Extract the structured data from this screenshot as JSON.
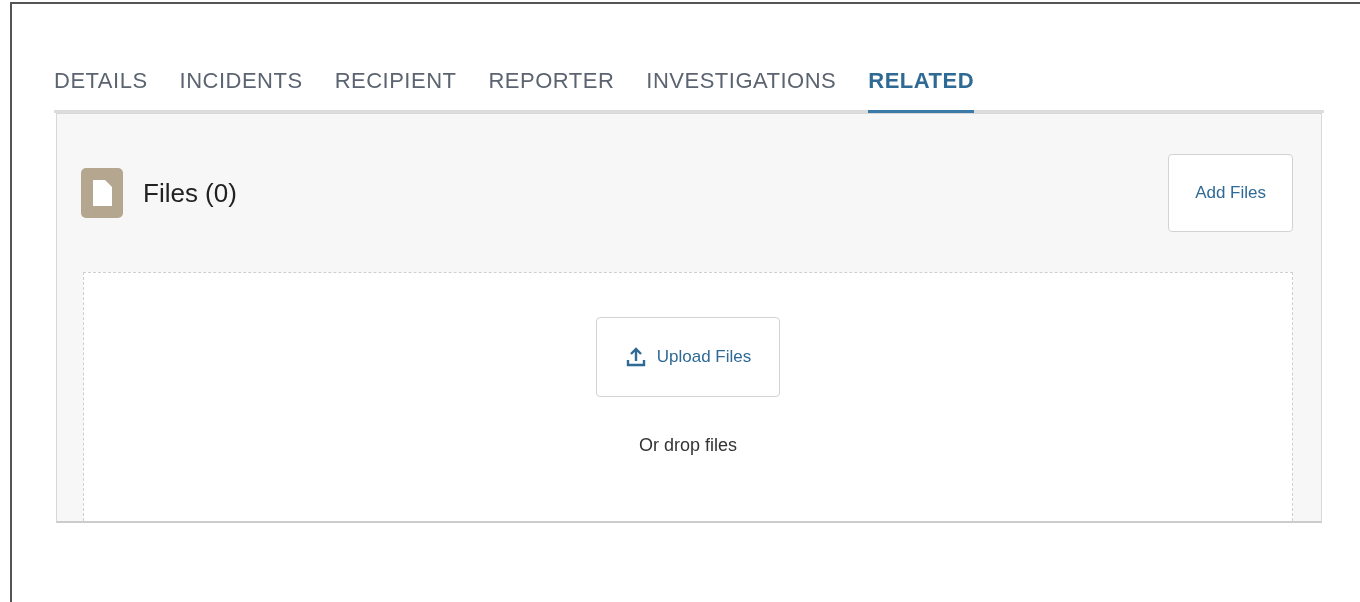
{
  "tabs": [
    {
      "label": "DETAILS",
      "selected": false
    },
    {
      "label": "INCIDENTS",
      "selected": false
    },
    {
      "label": "RECIPIENT",
      "selected": false
    },
    {
      "label": "REPORTER",
      "selected": false
    },
    {
      "label": "INVESTIGATIONS",
      "selected": false
    },
    {
      "label": "RELATED",
      "selected": true
    }
  ],
  "files_card": {
    "title": "Files (0)",
    "add_button": "Add Files",
    "upload_button": "Upload Files",
    "drop_hint": "Or drop files"
  }
}
